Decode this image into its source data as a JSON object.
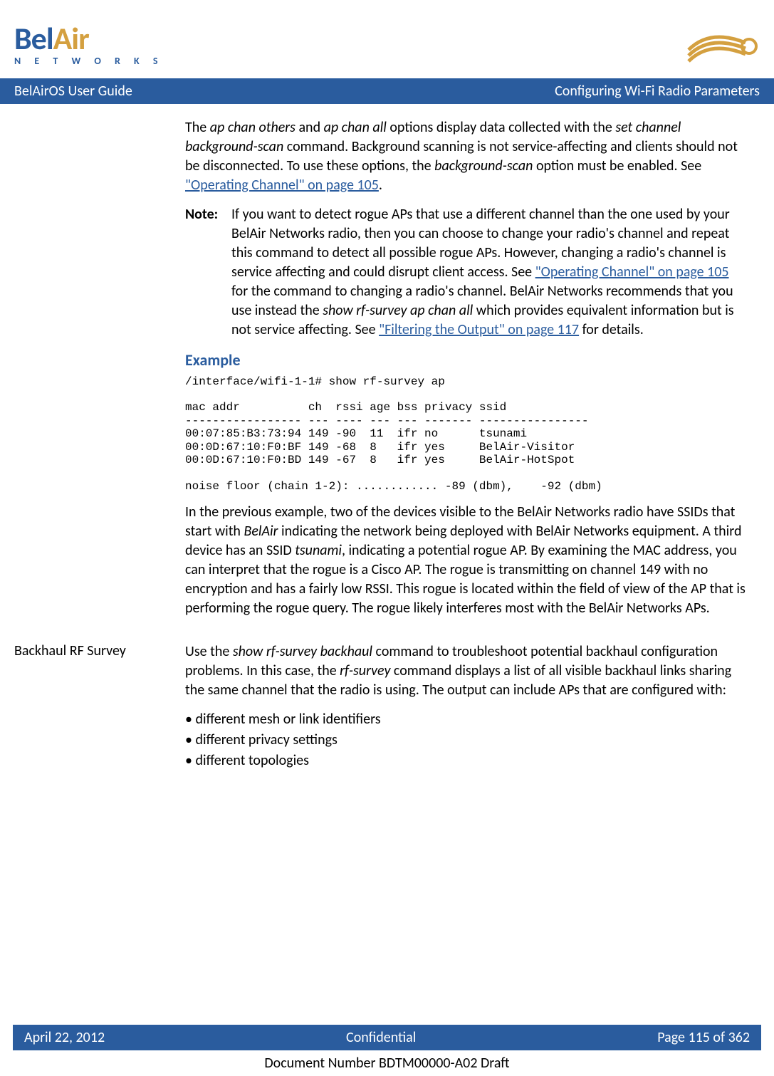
{
  "header": {
    "logo_bel": "Bel",
    "logo_air": "Air",
    "logo_networks": "N E T W O R K S"
  },
  "title_bar": {
    "left": "BelAirOS User Guide",
    "right": "Configuring Wi-Fi Radio Parameters"
  },
  "body": {
    "p1_t1": "The ",
    "p1_i1": "ap chan others",
    "p1_t2": " and ",
    "p1_i2": "ap chan all",
    "p1_t3": " options display data collected with the ",
    "p1_i3": "set channel background-scan",
    "p1_t4": " command. Background scanning is not service-affecting and clients should not be disconnected. To use these options, the ",
    "p1_i4": "background-scan",
    "p1_t5": " option must be enabled. See ",
    "p1_link": "\"Operating Channel\" on page 105",
    "p1_t6": ".",
    "note_label": "Note:",
    "note_t1": "If you want to detect rogue APs that use a different channel than the one used by your BelAir Networks radio, then you can choose to change your radio's channel and repeat this command to detect all possible rogue APs. However, changing a radio's channel is service affecting and could disrupt client access. See ",
    "note_link1": "\"Operating Channel\" on page 105",
    "note_t2": " for the command to changing a radio's channel. BelAir Networks recommends that you use instead the ",
    "note_i1": "show rf-survey ap chan all",
    "note_t3": " which provides equivalent information but is not service affecting. See ",
    "note_link2": "\"Filtering the Output\" on page 117",
    "note_t4": " for details.",
    "example_heading": "Example",
    "code": "/interface/wifi-1-1# show rf-survey ap\n\nmac addr          ch  rssi age bss privacy ssid\n----------------- --- ---- --- --- ------- ----------------\n00:07:85:B3:73:94 149 -90  11  ifr no      tsunami\n00:0D:67:10:F0:BF 149 -68  8   ifr yes     BelAir-Visitor\n00:0D:67:10:F0:BD 149 -67  8   ifr yes     BelAir-HotSpot\n\nnoise floor (chain 1-2): ............ -89 (dbm),    -92 (dbm)",
    "p2_t1": "In the previous example, two of the devices visible to the BelAir Networks radio have SSIDs that start with ",
    "p2_i1": "BelAir",
    "p2_t2": " indicating the network being deployed with BelAir Networks equipment. A third device has an SSID ",
    "p2_i2": "tsunami",
    "p2_t3": ", indicating a potential rogue AP. By examining the MAC address, you can interpret that the rogue is a Cisco AP. The rogue is transmitting on channel 149 with no encryption and has a fairly low RSSI. This rogue is located within the field of view of the AP that is performing the rogue query. The rogue likely interferes most with the BelAir Networks APs.",
    "section2_heading": "Backhaul RF Survey",
    "s2_t1": "Use the ",
    "s2_i1": "show rf-survey backhaul",
    "s2_t2": " command to troubleshoot potential backhaul configuration problems. In this case, the ",
    "s2_i2": "rf-survey",
    "s2_t3": " command displays a list of all visible backhaul links sharing the same channel that the radio is using. The output can include APs that are configured with:",
    "bullets": {
      "b1": "different mesh or link identifiers",
      "b2": "different privacy settings",
      "b3": "different topologies"
    }
  },
  "footer": {
    "left": "April 22, 2012",
    "center": "Confidential",
    "right": "Page 115 of 362",
    "doc_number": "Document Number BDTM00000-A02 Draft"
  }
}
